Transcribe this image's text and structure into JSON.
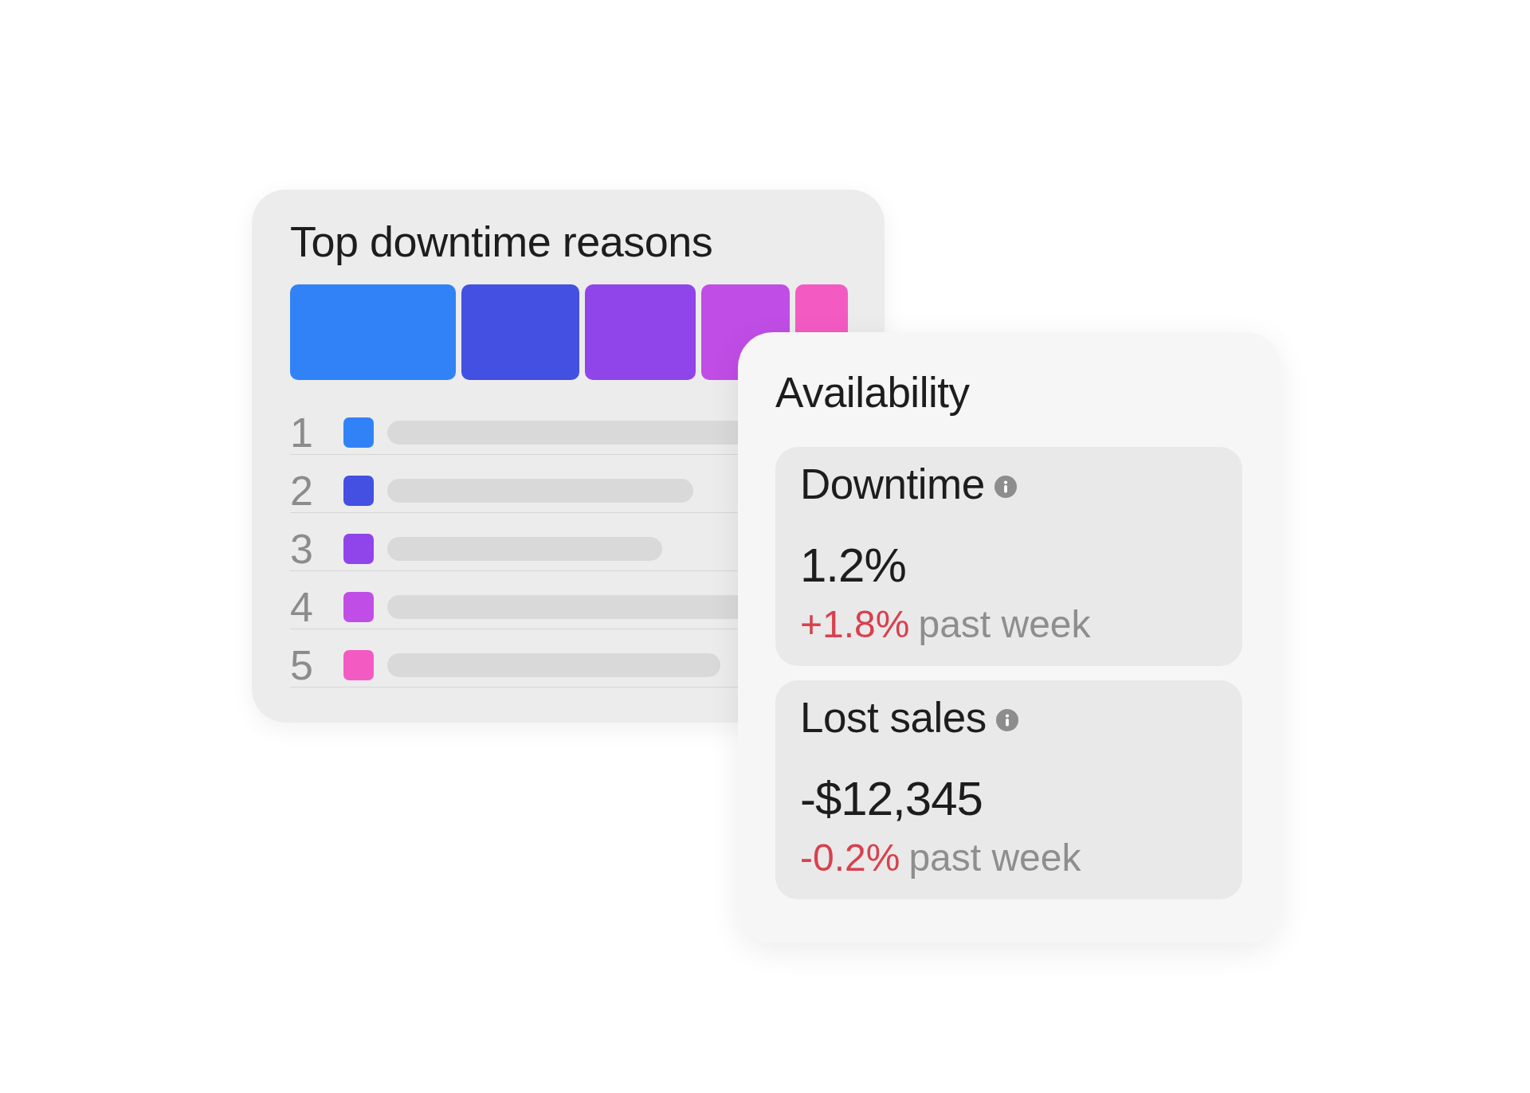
{
  "downtime_panel": {
    "title": "Top downtime reasons",
    "reasons": [
      {
        "rank": "1",
        "color": "#3182f6"
      },
      {
        "rank": "2",
        "color": "#4350e2"
      },
      {
        "rank": "3",
        "color": "#8f45ea"
      },
      {
        "rank": "4",
        "color": "#c04de6"
      },
      {
        "rank": "5",
        "color": "#f35bc3"
      }
    ]
  },
  "availability_panel": {
    "title": "Availability",
    "metrics": [
      {
        "label": "Downtime",
        "value": "1.2%",
        "change": "+1.8%",
        "negative": true,
        "period": "past week"
      },
      {
        "label": "Lost sales",
        "value": "-$12,345",
        "change": "-0.2%",
        "negative": true,
        "period": "past week"
      }
    ]
  }
}
